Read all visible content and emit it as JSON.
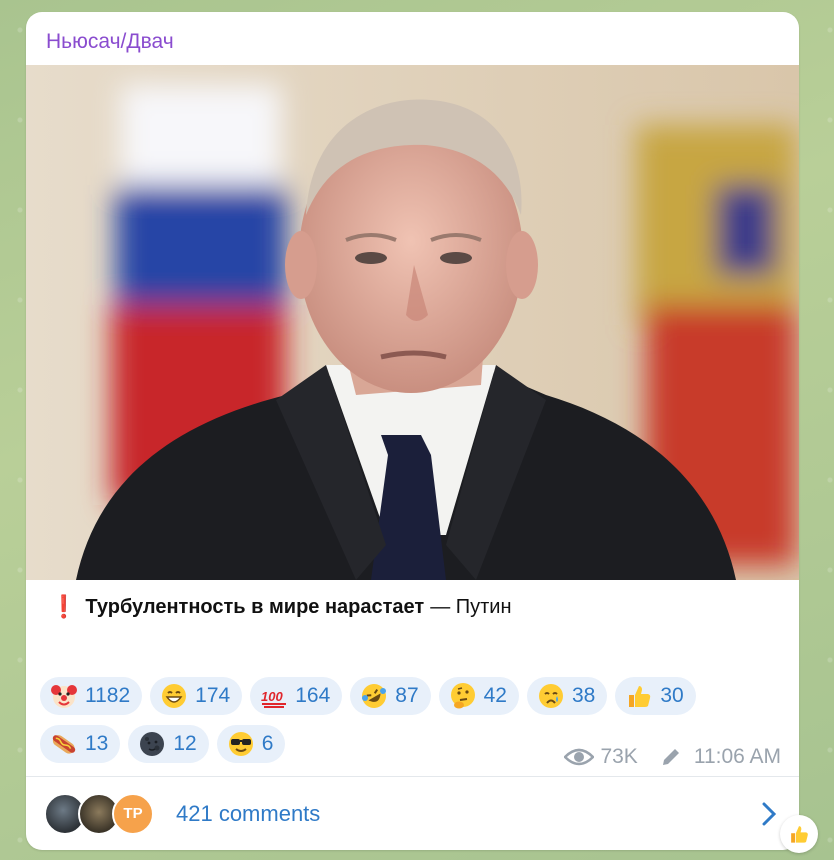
{
  "channel": {
    "name": "Ньюсач/Двач"
  },
  "post": {
    "caption": {
      "mark": "❗",
      "bold_text": "Турбулентность в мире нарастает",
      "rest_text": "— Путин"
    },
    "photo_alt_icon": "photo"
  },
  "reactions": [
    {
      "icon": "clown-icon",
      "count": "1182"
    },
    {
      "icon": "grin-icon",
      "count": "174"
    },
    {
      "icon": "hundred-icon",
      "count": "164"
    },
    {
      "icon": "rofl-icon",
      "count": "87"
    },
    {
      "icon": "thinking-icon",
      "count": "42"
    },
    {
      "icon": "cry-icon",
      "count": "38"
    },
    {
      "icon": "thumbs-up-icon",
      "count": "30"
    },
    {
      "icon": "hotdog-icon",
      "count": "13"
    },
    {
      "icon": "new-moon-face-icon",
      "count": "12"
    },
    {
      "icon": "sunglasses-icon",
      "count": "6"
    }
  ],
  "meta": {
    "views": "73K",
    "time": "11:06 AM"
  },
  "comments": {
    "label": "421 comments",
    "avatar_initials": "TP"
  },
  "colors": {
    "accent": "#2f7ac7",
    "channel": "#8a4ccf",
    "reaction_bg": "#e8f0fa"
  }
}
